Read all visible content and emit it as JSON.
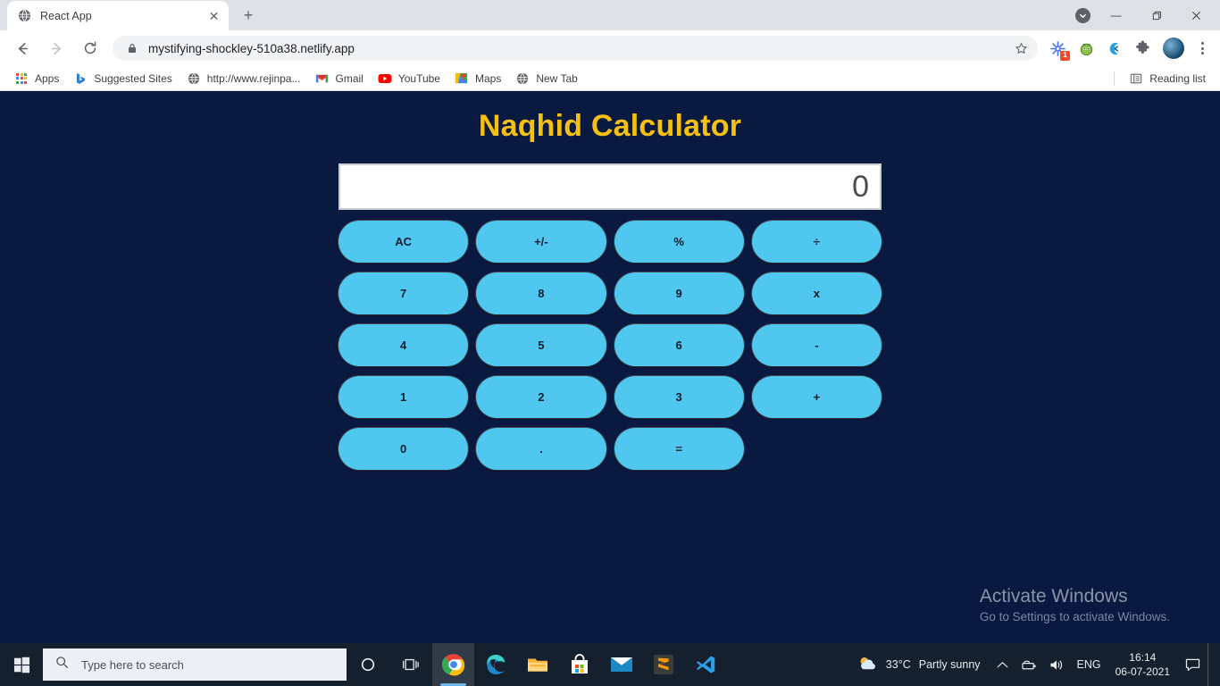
{
  "browser": {
    "tab": {
      "title": "React App",
      "favicon": "globe-icon",
      "close": "✕"
    },
    "new_tab_label": "+",
    "window_controls": {
      "download": "chevron-down-icon",
      "minimize": "—",
      "maximize": "❐",
      "close": "✕"
    },
    "nav": {
      "back": "←",
      "forward": "→",
      "reload": "⟳"
    },
    "omnibox": {
      "lock": "lock-icon",
      "url": "mystifying-shockley-510a38.netlify.app",
      "star": "☆"
    },
    "extensions": {
      "badge_count": "1"
    },
    "bookmarks": [
      {
        "label": "Apps",
        "icon": "apps-grid-icon"
      },
      {
        "label": "Suggested Sites",
        "icon": "bing-icon"
      },
      {
        "label": "http://www.rejinpa...",
        "icon": "globe-icon"
      },
      {
        "label": "Gmail",
        "icon": "gmail-icon"
      },
      {
        "label": "YouTube",
        "icon": "youtube-icon"
      },
      {
        "label": "Maps",
        "icon": "maps-icon"
      },
      {
        "label": "New Tab",
        "icon": "globe-icon"
      }
    ],
    "reading_list": {
      "label": "Reading list",
      "icon": "reading-list-icon"
    }
  },
  "page": {
    "title": "Naqhid Calculator",
    "title_color": "#f6c013",
    "background_color": "#0a1940",
    "display_value": "0",
    "key_color": "#4fc7ef",
    "keys": [
      "AC",
      "+/-",
      "%",
      "÷",
      "7",
      "8",
      "9",
      "x",
      "4",
      "5",
      "6",
      "-",
      "1",
      "2",
      "3",
      "+",
      "0",
      ".",
      "="
    ]
  },
  "watermark": {
    "line1": "Activate Windows",
    "line2": "Go to Settings to activate Windows."
  },
  "taskbar": {
    "start": "windows-logo-icon",
    "search_placeholder": "Type here to search",
    "cortana": "cortana-circle-icon",
    "task_view": "task-view-icon",
    "apps": [
      {
        "name": "chrome-icon",
        "active": true
      },
      {
        "name": "edge-icon",
        "active": false
      },
      {
        "name": "file-explorer-icon",
        "active": false
      },
      {
        "name": "microsoft-store-icon",
        "active": false
      },
      {
        "name": "mail-icon",
        "active": false
      },
      {
        "name": "sublime-text-icon",
        "active": false
      },
      {
        "name": "vscode-icon",
        "active": false
      }
    ],
    "weather": {
      "temperature": "33°C",
      "condition": "Partly sunny",
      "icon": "partly-sunny-icon"
    },
    "tray": {
      "chevron": "∧",
      "network": "network-icon",
      "volume": "volume-icon",
      "language": "ENG"
    },
    "clock": {
      "time": "16:14",
      "date": "06-07-2021"
    },
    "action_center": "action-center-icon"
  }
}
